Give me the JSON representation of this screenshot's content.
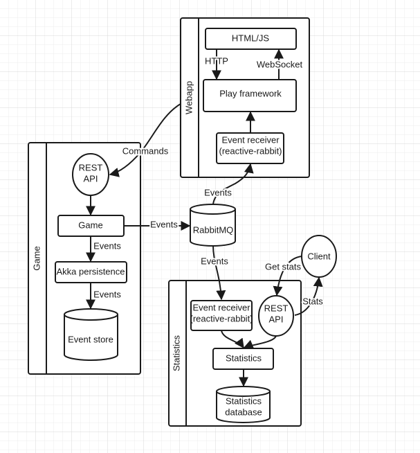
{
  "colors": {
    "stroke": "#1a1a1a",
    "grid_minor": "#ececec",
    "grid_major": "#d8d8d8",
    "background": "#ffffff"
  },
  "pools": {
    "webapp": "Webapp",
    "game": "Game",
    "statistics": "Statistics"
  },
  "nodes": {
    "html_js": "HTML/JS",
    "play": "Play framework",
    "webapp_receiver": [
      "Event receiver",
      "(reactive-rabbit)"
    ],
    "game_rest": [
      "REST",
      "API"
    ],
    "game": "Game",
    "akka": "Akka persistence",
    "event_store": "Event store",
    "rabbitmq": "RabbitMQ",
    "stats_receiver": [
      "Event receiver",
      "(reactive-rabbit)"
    ],
    "stats_rest": [
      "REST",
      "API"
    ],
    "client": "Client",
    "statistics": "Statistics",
    "stats_db": [
      "Statistics",
      "database"
    ]
  },
  "edges": {
    "http": "HTTP",
    "websocket": "WebSocket",
    "commands": "Commands",
    "events_rabbit_webapp": "Events",
    "events_game_rabbit": "Events",
    "events_game_akka": "Events",
    "events_akka_store": "Events",
    "events_rabbit_stats": "Events",
    "get_stats": "Get stats",
    "stats": "Stats"
  }
}
